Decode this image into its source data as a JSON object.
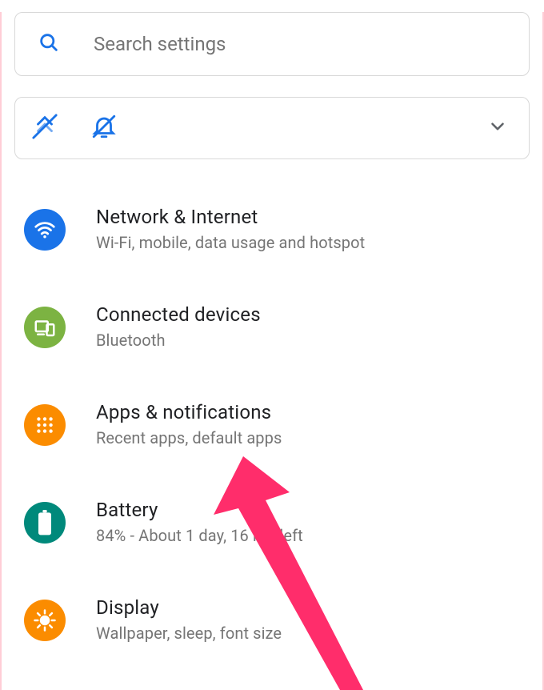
{
  "search": {
    "placeholder": "Search settings"
  },
  "settings": [
    {
      "title": "Network & Internet",
      "subtitle": "Wi-Fi, mobile, data usage and hotspot"
    },
    {
      "title": "Connected devices",
      "subtitle": "Bluetooth"
    },
    {
      "title": "Apps & notifications",
      "subtitle": "Recent apps, default apps"
    },
    {
      "title": "Battery",
      "subtitle": "84% - About 1 day, 16 hrs left"
    },
    {
      "title": "Display",
      "subtitle": "Wallpaper, sleep, font size"
    }
  ],
  "colors": {
    "accent_blue": "#1a73e8",
    "accent_green": "#7cb342",
    "accent_orange": "#fb8c00",
    "accent_teal": "#00897b",
    "arrow": "#ff2d6b"
  }
}
